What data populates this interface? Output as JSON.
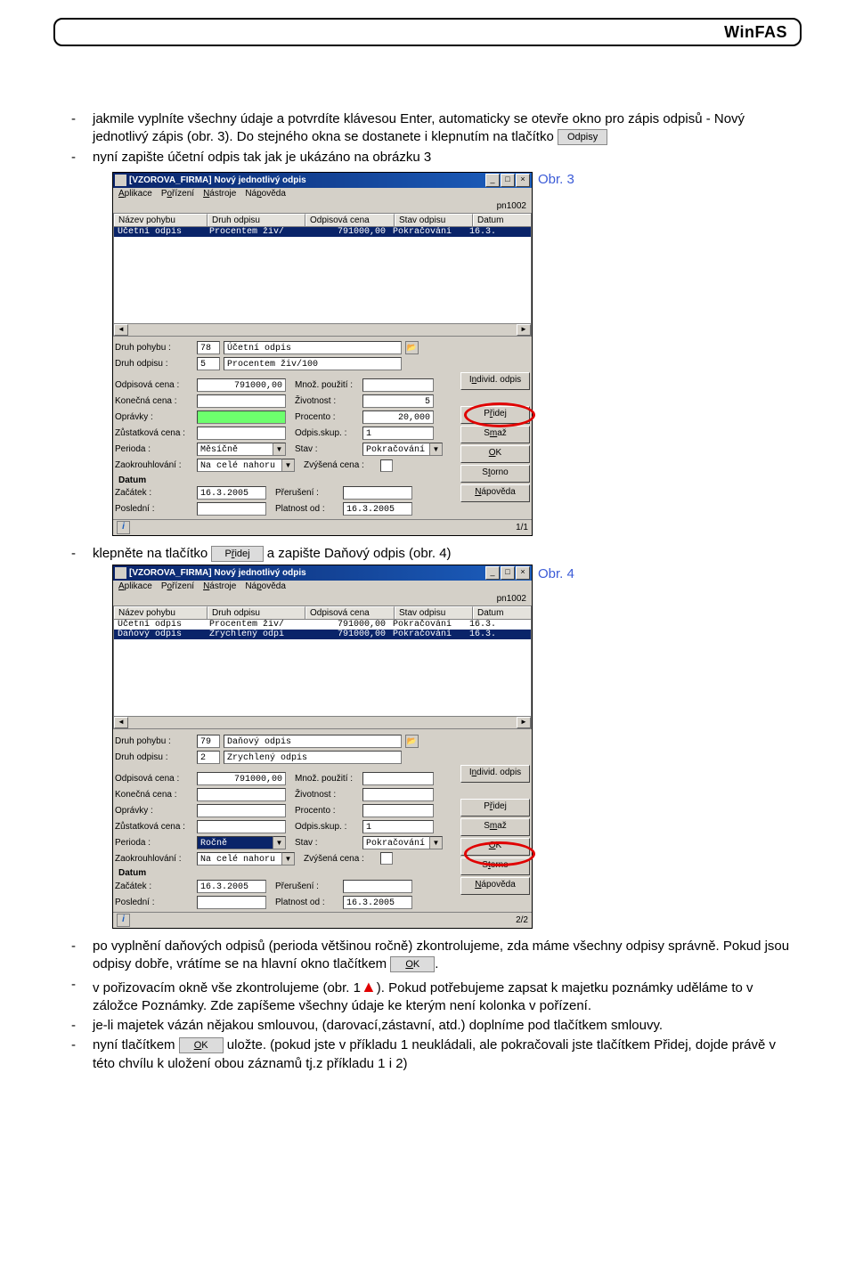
{
  "brand": "WinFAS",
  "para1_line1": "jakmile vyplníte všechny údaje a potvrdíte klávesou Enter, automaticky se otevře okno pro zápis odpisů -",
  "para1_line2": "Nový jednotlivý zápis (obr. 3). Do stejného okna se dostanete i klepnutím na tlačítko",
  "btn_odpisy": "Odpisy",
  "para2": "nyní zapište účetní odpis tak jak je ukázáno na obrázku 3",
  "fig3": "Obr. 3",
  "para3a": "klepněte na tlačítko",
  "btn_pridej_inline": {
    "pre": "P",
    "u": "ř",
    "post": "idej"
  },
  "para3b": "a zapište Daňový odpis (obr. 4)",
  "fig4": "Obr. 4",
  "para4a": "po vyplnění daňových odpisů (perioda většinou ročně) zkontrolujeme, zda máme všechny odpisy správně. Pokud jsou odpisy dobře, vrátíme se na hlavní okno tlačítkem",
  "btn_ok_inline": {
    "pre": "",
    "u": "O",
    "post": "K"
  },
  "para4b": ".",
  "para5a": "v pořizovacím okně vše zkontrolujeme (obr. 1",
  "para5b": "). Pokud potřebujeme zapsat k majetku poznámky uděláme to v záložce Poznámky. Zde zapíšeme všechny údaje ke kterým není kolonka v pořízení.",
  "para6": "je-li majetek vázán nějakou smlouvou, (darovací,zástavní, atd.) doplníme pod tlačítkem smlouvy.",
  "para7a": "nyní tlačítkem",
  "para7b": "uložte. (pokud jste v příkladu 1 neukládali, ale pokračovali jste tlačítkem Přidej, dojde právě v této chvílu k uložení obou záznamů tj.z příkladu 1 i 2)",
  "win": {
    "title": "[VZOROVA_FIRMA] Nový jednotlivý odpis",
    "menu": [
      {
        "pre": "",
        "u": "A",
        "post": "plikace"
      },
      {
        "pre": "P",
        "u": "o",
        "post": "řízení"
      },
      {
        "pre": "",
        "u": "N",
        "post": "ástroje"
      },
      {
        "pre": "Ná",
        "u": "p",
        "post": "ověda"
      }
    ],
    "code": "pn1002",
    "cols": {
      "c1": "Název pohybu",
      "c2": "Druh odpisu",
      "c3": "Odpisová cena",
      "c4": "Stav odpisu",
      "c5": "Datum"
    },
    "win3": {
      "rows": [
        {
          "sel": true,
          "c1": "Účetní odpis",
          "c2": "Procentem živ/",
          "c3": "791000,00",
          "c4": "Pokračování",
          "c5": "16.3."
        }
      ],
      "form": {
        "druh_pohybu_code": "78",
        "druh_pohybu_name": "Účetní odpis",
        "druh_odpisu_code": "5",
        "druh_odpisu_name": "Procentem živ/100",
        "odpis_cena": "791000,00",
        "mnoz": "",
        "konecna": "",
        "zivotnost": "5",
        "opravky_green": "",
        "procento": "20,000",
        "zustat": "",
        "odpis_skup": "1",
        "perioda": "Měsíčně",
        "stav": "Pokračování",
        "zaokr": "Na celé nahoru",
        "zvysena": "",
        "zacatek": "16.3.2005",
        "preruseni": "",
        "posledni": "",
        "platnost": "16.3.2005",
        "status": "1/1",
        "green_opravky": true
      }
    },
    "win4": {
      "rows": [
        {
          "sel": false,
          "c1": "Účetní odpis",
          "c2": "Procentem živ/",
          "c3": "791000,00",
          "c4": "Pokračování",
          "c5": "16.3."
        },
        {
          "sel": true,
          "c1": "Daňový odpis",
          "c2": "Zrychlený odpi",
          "c3": "791000,00",
          "c4": "Pokračování",
          "c5": "16.3."
        }
      ],
      "form": {
        "druh_pohybu_code": "79",
        "druh_pohybu_name": "Daňový odpis",
        "druh_odpisu_code": "2",
        "druh_odpisu_name": "Zrychlený odpis",
        "odpis_cena": "791000,00",
        "mnoz": "",
        "konecna": "",
        "zivotnost": "",
        "opravky_green": "",
        "procento": "",
        "zustat": "",
        "odpis_skup": "1",
        "perioda": "Ročně",
        "perioda_sel": true,
        "stav": "Pokračování",
        "zaokr": "Na celé nahoru",
        "zvysena": "",
        "zacatek": "16.3.2005",
        "preruseni": "",
        "posledni": "",
        "platnost": "16.3.2005",
        "status": "2/2"
      }
    },
    "lbl": {
      "druh_pohybu": "Druh pohybu :",
      "druh_odpisu": "Druh odpisu :",
      "odpis_cena": "Odpisová cena :",
      "mnoz": "Množ. použití :",
      "konecna": "Konečná cena :",
      "zivotnost": "Životnost :",
      "opravky": "Oprávky :",
      "procento": "Procento :",
      "zustat": "Zůstatková cena :",
      "odpis_skup": "Odpis.skup. :",
      "perioda": "Perioda :",
      "stav": "Stav :",
      "zaokr": "Zaokrouhlování :",
      "zvysena": "Zvýšená cena :",
      "datum": "Datum",
      "zacatek": "Začátek :",
      "preruseni": "Přerušení :",
      "posledni": "Poslední :",
      "platnost": "Platnost od :"
    },
    "btns": {
      "individ": {
        "pre": "I",
        "u": "n",
        "post": "divid. odpis"
      },
      "pridej": {
        "pre": "P",
        "u": "ř",
        "post": "idej"
      },
      "smaz": {
        "pre": "S",
        "u": "m",
        "post": "až"
      },
      "ok": {
        "pre": "",
        "u": "O",
        "post": "K"
      },
      "storno": {
        "pre": "S",
        "u": "t",
        "post": "orno"
      },
      "napoveda": {
        "pre": "",
        "u": "N",
        "post": "ápověda"
      }
    }
  }
}
